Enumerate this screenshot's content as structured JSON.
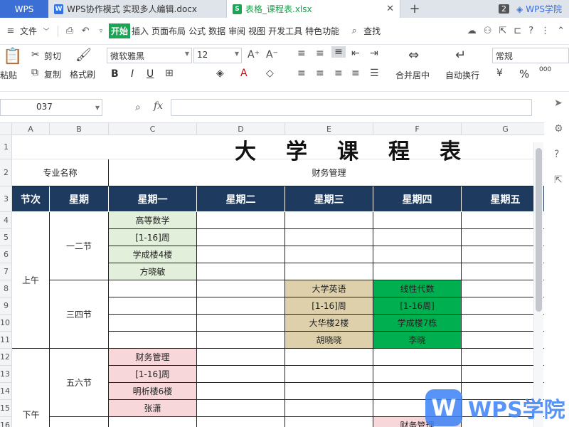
{
  "tabs": {
    "wps": "WPS",
    "doc": "WPS协作模式 实现多人编辑.docx",
    "xls": "表格_课程表.xlsx",
    "count": "2",
    "academy": "WPS学院"
  },
  "menu": {
    "file": "文件",
    "items": [
      "开始",
      "插入",
      "页面布局",
      "公式",
      "数据",
      "审阅",
      "视图",
      "开发工具",
      "特色功能"
    ],
    "search": "查找"
  },
  "ribbon": {
    "paste": "粘贴",
    "cut": "剪切",
    "copy": "复制",
    "format_painter": "格式刷",
    "font_name": "微软雅黑",
    "font_size": "12",
    "bold": "B",
    "italic": "I",
    "underline": "U",
    "merge": "合并居中",
    "wrap": "自动换行",
    "num_format": "常规",
    "percent": "%",
    "thousands": "000"
  },
  "formula": {
    "cell_ref": "037",
    "fx": "fx"
  },
  "grid": {
    "columns": [
      "A",
      "B",
      "C",
      "D",
      "E",
      "F",
      "G"
    ],
    "rows": [
      "1",
      "2",
      "3",
      "4",
      "5",
      "6",
      "7",
      "8",
      "9",
      "10",
      "11",
      "12",
      "13",
      "14",
      "15",
      "16"
    ],
    "title": "大学课程表",
    "major_label": "专业名称",
    "major_value": "财务管理",
    "header": [
      "节次",
      "星期",
      "星期一",
      "星期二",
      "星期三",
      "星期四",
      "星期五"
    ],
    "am": "上午",
    "pm": "下午",
    "p12": "一二节",
    "p34": "三四节",
    "p56": "五六节",
    "mon_12": [
      "高等数学",
      "[1-16]周",
      "学成楼4楼",
      "方晓敏"
    ],
    "wed_34": [
      "大学英语",
      "[1-16]周",
      "大华楼2楼",
      "胡晓晓"
    ],
    "thu_34": [
      "线性代数",
      "[1-16周]",
      "学成楼7栋",
      "李晓"
    ],
    "mon_56": [
      "财务管理",
      "[1-16]周",
      "明析楼6楼",
      "张潇"
    ],
    "thu_78_partial": "财务管理"
  },
  "watermark": {
    "text": "WPS学院"
  },
  "colors": {
    "navy": "#1e3a5f",
    "green_light": "#e2efda",
    "tan": "#ddd0ab",
    "green_bright": "#00b050",
    "pink": "#f8d7da"
  }
}
